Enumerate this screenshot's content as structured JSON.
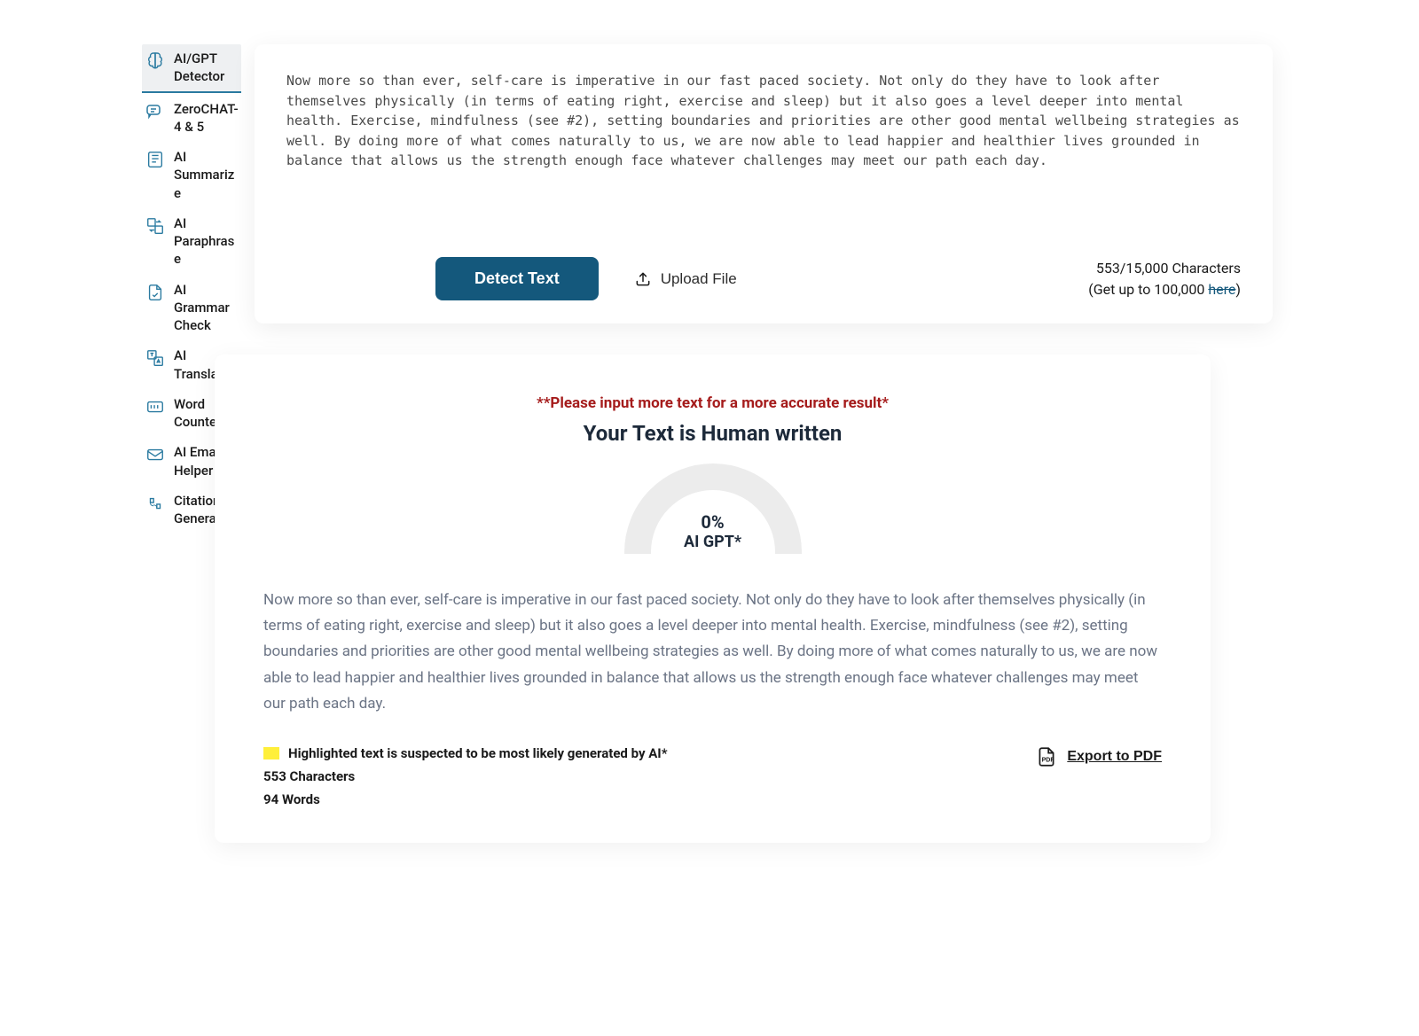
{
  "sidebar": {
    "items": [
      {
        "label": "AI/GPT Detector"
      },
      {
        "label": "ZeroCHAT-4 & 5"
      },
      {
        "label": "AI Summarize"
      },
      {
        "label": "AI Paraphrase"
      },
      {
        "label": "AI Grammar Check"
      },
      {
        "label": "AI Translator"
      },
      {
        "label": "Word Counter"
      },
      {
        "label": "AI Email Helper"
      },
      {
        "label": "Citation Generator"
      }
    ]
  },
  "input": {
    "text": "Now more so than ever, self-care is imperative in our fast paced society. Not only do they have to look after themselves physically (in terms of eating right, exercise and sleep) but it also goes a level deeper into mental health. Exercise, mindfulness (see #2), setting boundaries and priorities are other good mental wellbeing strategies as well. By doing more of what comes naturally to us, we are now able to lead happier and healthier lives grounded in balance that allows us the strength enough face whatever challenges may meet our path each day.",
    "detect_label": "Detect Text",
    "upload_label": "Upload File",
    "counter_line1": "553/15,000 Characters",
    "counter_line2_pre": "(Get up to 100,000 ",
    "counter_line2_link": "here",
    "counter_line2_post": ")"
  },
  "result": {
    "warning": "**Please input more text for a more accurate result*",
    "verdict": "Your Text is Human written",
    "gauge_pct": "0%",
    "gauge_label": "AI GPT*",
    "body": "Now more so than ever, self-care is imperative in our fast paced society. Not only do they have to look after themselves physically (in terms of eating right, exercise and sleep) but it also goes a level deeper into mental health. Exercise, mindfulness (see #2), setting boundaries and priorities are other good mental wellbeing strategies as well. By doing more of what comes naturally to us, we are now able to lead happier and healthier lives grounded in balance that allows us the strength enough face whatever challenges may meet our path each day.",
    "highlight_note": "Highlighted text is suspected to be most likely generated by AI*",
    "chars_line": "553 Characters",
    "words_line": "94 Words",
    "export_label": "Export to PDF"
  }
}
